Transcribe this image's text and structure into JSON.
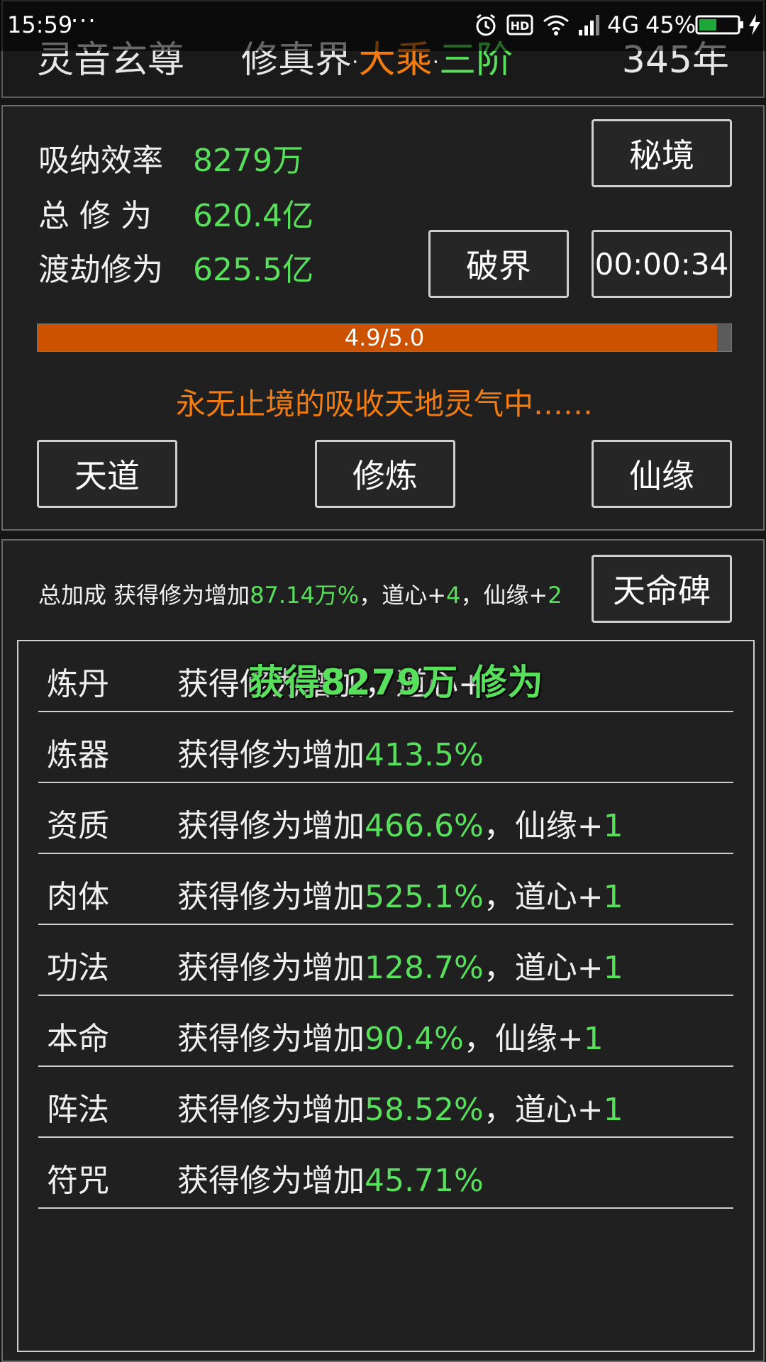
{
  "status_bar": {
    "time": "15:59",
    "dots": "···",
    "network": "4G",
    "battery": "45%"
  },
  "header": {
    "title": "灵音玄尊",
    "realm_world": "修真界",
    "sep": "·",
    "realm_stage": "大乘",
    "realm_level": "三阶",
    "years": "345年"
  },
  "stats": {
    "absorb_label": "吸纳效率",
    "absorb_value": "8279万",
    "total_label": "总 修 为",
    "total_value": "620.4亿",
    "tribulation_label": "渡劫修为",
    "tribulation_value": "625.5亿"
  },
  "buttons": {
    "secret_realm": "秘境",
    "break_realm": "破界",
    "timer": "00:00:34",
    "heaven_dao": "天道",
    "cultivate": "修炼",
    "immortal_fate": "仙缘",
    "fate_stele": "天命碑"
  },
  "progress": {
    "label": "4.9/5.0",
    "value": 4.9,
    "max": 5.0
  },
  "message": "永无止境的吸收天地灵气中……",
  "bonus_summary": {
    "prefix": "总加成 获得修为增加",
    "percent": "87.14万%",
    "mid1": "，道心+",
    "dao": "4",
    "mid2": "，仙缘+",
    "fate": "2"
  },
  "bonus_rows": [
    {
      "name": "炼丹",
      "prefix": "获得修为增加",
      "value": "",
      "extra_label": "，道心+",
      "extra_value": "1"
    },
    {
      "name": "炼器",
      "prefix": "获得修为增加",
      "value": "413.5%",
      "extra_label": "",
      "extra_value": ""
    },
    {
      "name": "资质",
      "prefix": "获得修为增加",
      "value": "466.6%",
      "extra_label": "，仙缘+",
      "extra_value": "1"
    },
    {
      "name": "肉体",
      "prefix": "获得修为增加",
      "value": "525.1%",
      "extra_label": "，道心+",
      "extra_value": "1"
    },
    {
      "name": "功法",
      "prefix": "获得修为增加",
      "value": "128.7%",
      "extra_label": "，道心+",
      "extra_value": "1"
    },
    {
      "name": "本命",
      "prefix": "获得修为增加",
      "value": "90.4%",
      "extra_label": "，仙缘+",
      "extra_value": "1"
    },
    {
      "name": "阵法",
      "prefix": "获得修为增加",
      "value": "58.52%",
      "extra_label": "，道心+",
      "extra_value": "1"
    },
    {
      "name": "符咒",
      "prefix": "获得修为增加",
      "value": "45.71%",
      "extra_label": "",
      "extra_value": ""
    }
  ],
  "floating_gain": "获得8279万 修为",
  "colors": {
    "green": "#58e05c",
    "orange": "#f27c12",
    "progress_fill": "#cc5200",
    "battery": "#1fa83a"
  },
  "icons": [
    "alarm-icon",
    "hd-icon",
    "wifi-icon",
    "signal-icon",
    "battery-icon",
    "charging-icon"
  ]
}
